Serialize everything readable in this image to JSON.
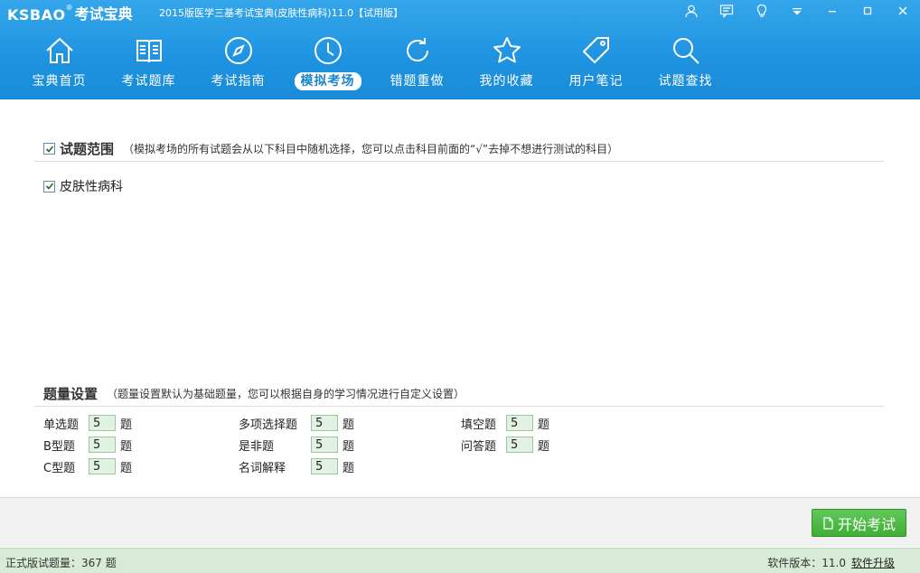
{
  "app": {
    "logo_en": "KSBAO",
    "logo_reg": "®",
    "logo_cn": "考试宝典",
    "window_title": "2015版医学三基考试宝典(皮肤性病科)11.0【试用版】"
  },
  "nav": {
    "items": [
      {
        "label": "宝典首页",
        "icon": "home-icon"
      },
      {
        "label": "考试题库",
        "icon": "book-icon"
      },
      {
        "label": "考试指南",
        "icon": "compass-icon"
      },
      {
        "label": "模拟考场",
        "icon": "clock-icon",
        "active": true
      },
      {
        "label": "错题重做",
        "icon": "refresh-icon"
      },
      {
        "label": "我的收藏",
        "icon": "star-icon"
      },
      {
        "label": "用户笔记",
        "icon": "tag-icon"
      },
      {
        "label": "试题查找",
        "icon": "search-icon"
      }
    ]
  },
  "scope": {
    "title": "试题范围",
    "description": "（模拟考场的所有试题会从以下科目中随机选择，您可以点击科目前面的“√”去掉不想进行测试的科目）",
    "subject": "皮肤性病科",
    "checked": true
  },
  "quantity": {
    "title": "题量设置",
    "description": "（题量设置默认为基础题量，您可以根据自身的学习情况进行自定义设置）",
    "unit": "题",
    "items": [
      {
        "name": "单选题",
        "value": "5"
      },
      {
        "name": "多项选择题",
        "value": "5"
      },
      {
        "name": "填空题",
        "value": "5"
      },
      {
        "name": "B型题",
        "value": "5"
      },
      {
        "name": "是非题",
        "value": "5"
      },
      {
        "name": "问答题",
        "value": "5"
      },
      {
        "name": "C型题",
        "value": "5"
      },
      {
        "name": "名词解释",
        "value": "5"
      }
    ]
  },
  "actions": {
    "start_exam": "开始考试"
  },
  "status": {
    "count_text": "正式版试题量：367 题",
    "version_label": "软件版本：",
    "version": "11.0",
    "upgrade": "软件升级"
  },
  "colors": {
    "topbar": "#1e93e0",
    "start_button": "#3fae36",
    "statusbar": "#d8ead8"
  }
}
